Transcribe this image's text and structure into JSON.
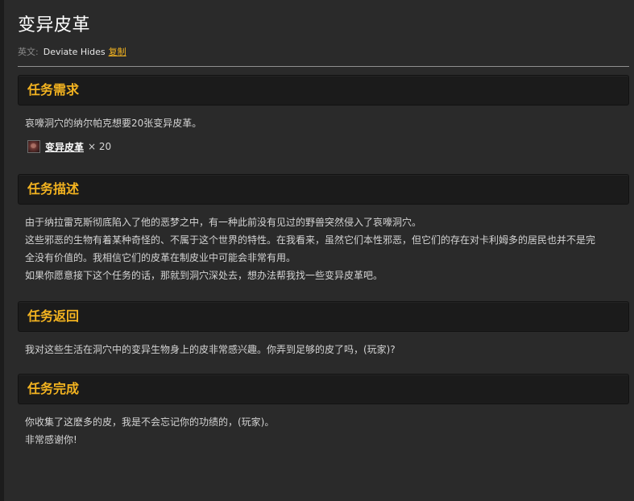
{
  "quest": {
    "title": "变异皮革",
    "english_prefix": "英文:",
    "english_name": "Deviate Hides",
    "copy_label": "复制"
  },
  "requirements": {
    "heading": "任务需求",
    "text": "哀嚎洞穴的纳尔帕克想要20张变异皮革。",
    "item": {
      "icon": "deviate-hide-icon",
      "name": "变异皮革",
      "quantity": "× 20"
    }
  },
  "description": {
    "heading": "任务描述",
    "lines": [
      "由于纳拉雷克斯彻底陷入了他的恶梦之中，有一种此前没有见过的野兽突然侵入了哀嚎洞穴。",
      "这些邪恶的生物有着某种奇怪的、不属于这个世界的特性。在我看来，虽然它们本性邪恶，但它们的存在对卡利姆多的居民也并不是完",
      "全没有价值的。我相信它们的皮革在制皮业中可能会非常有用。",
      "如果你愿意接下这个任务的话，那就到洞穴深处去，想办法帮我找一些变异皮革吧。"
    ]
  },
  "return": {
    "heading": "任务返回",
    "text": "我对这些生活在洞穴中的变异生物身上的皮非常感兴趣。你弄到足够的皮了吗，(玩家)?"
  },
  "completion": {
    "heading": "任务完成",
    "lines": [
      "你收集了这麽多的皮，我是不会忘记你的功绩的，(玩家)。",
      "非常感谢你!"
    ]
  },
  "colors": {
    "accent": "#f3b320",
    "background": "#2a2a2a",
    "header_bg": "#1b1b1b",
    "text": "#d4d4d4"
  }
}
